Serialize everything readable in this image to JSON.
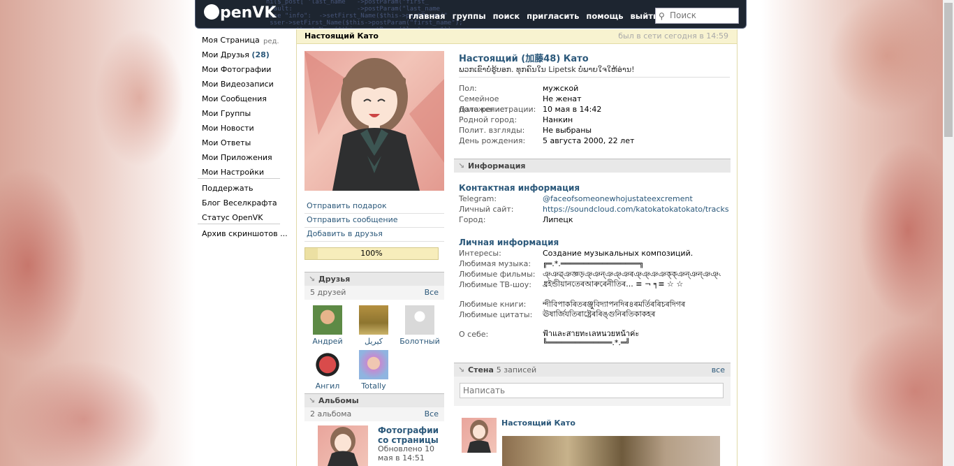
{
  "header": {
    "logo": "penVK",
    "nav": [
      "главная",
      "группы",
      "поиск",
      "пригласить",
      "помощь",
      "выйти"
    ],
    "search_placeholder": "Поиск"
  },
  "sidebar": {
    "my_page": "Моя Страница",
    "edit": "ред.",
    "friends": "Мои Друзья",
    "friends_count": "28",
    "items": [
      "Мои Фотографии",
      "Мои Видеозаписи",
      "Мои Сообщения",
      "Мои Группы",
      "Мои Новости",
      "Мои Ответы",
      "Мои Приложения",
      "Мои Настройки"
    ],
    "items2": [
      "Поддержать",
      "Блог Веселкрафта",
      "Статус OpenVK"
    ],
    "items3": [
      "Архив скриншотов ..."
    ]
  },
  "titlebar": {
    "name": "Настоящий Като",
    "online": "был в сети сегодня в 14:59"
  },
  "actions": [
    "Отправить подарок",
    "Отправить сообщение",
    "Добавить в друзья"
  ],
  "progress": {
    "label": "100%",
    "value": 100
  },
  "friends": {
    "title": "Друзья",
    "count": "5 друзей",
    "all": "Все",
    "list": [
      {
        "name": "Андрей",
        "color": "#6a8a4a"
      },
      {
        "name": "کیریل",
        "color": "#a8863a"
      },
      {
        "name": "Болотный",
        "color": "#d9d9d9"
      },
      {
        "name": "Ангил",
        "color": "#c23a3a"
      },
      {
        "name": "Totally",
        "color": "#b8a0d8"
      }
    ]
  },
  "albums": {
    "title": "Альбомы",
    "count": "2 альбома",
    "all": "Все",
    "first_title": "Фотографии со страницы",
    "first_updated": "Обновлено 10 мая в 14:51"
  },
  "profile": {
    "full_name": "Настоящий (加藤48) Като",
    "status": "ພວກເຂົາບໍ່ຮູ້ບອກ. ທຸກຄົນໃນ Lipetsk ບໍ່ພາຍໃຈໃຫ້ອ່ານ!",
    "basic": [
      {
        "k": "Пол:",
        "v": "мужской"
      },
      {
        "k": "Семейное положение:",
        "v": "Не женат"
      },
      {
        "k": "Дата регистрации:",
        "v": "10 мая в 14:42"
      },
      {
        "k": "Родной город:",
        "v": "Нанкин"
      },
      {
        "k": "Полит. взгляды:",
        "v": "Не выбраны"
      },
      {
        "k": "День рождения:",
        "v": "5 августа 2000, 22 лет"
      }
    ],
    "info_header": "Информация",
    "contact_title": "Контактная информация",
    "contact": [
      {
        "k": "Telegram:",
        "v": "@faceofsomeonewhojustateexcrement"
      },
      {
        "k": "Личный сайт:",
        "v": "https://soundcloud.com/katokatokatokato/tracks"
      },
      {
        "k": "Город:",
        "v": "Липецк"
      }
    ],
    "personal_title": "Личная информация",
    "personal": [
      {
        "k": "Интересы:",
        "v": "Создание музыкальных композиций."
      },
      {
        "k": "Любимая музыка:",
        "v": "╔═.*.═════════════════╗"
      },
      {
        "k": "Любимые фильмы:",
        "v": "ঞ্ঞৱ্ঞজ্ঞড়ঞ্ঞন্ঞঞ্ঞৰঞ্ঞ্ঞঞক্ক্ঞন্ঞন্ঞঞ্ঞন্ঞ"
      },
      {
        "k": "Любимые ТВ-шоу:",
        "v": "ধ্ৰইন্ডীয়ানতেৰআৰুৰেনীতিৰ... ≡ ¬ ╕≡ ☆ ☆"
      },
      {
        "k": "Любимые книги:",
        "v": "ন্দীবিপাকৰিতৰঞ্জুবিদ্যাপনদিৰ৪ৰমৰ্তিৰৰিচৰদিগৰ"
      },
      {
        "k": "Любимые цитаты:",
        "v": "ঊষাৰ্জিযতিৰাষ্ট্ৰেৰৰিঙ্গুনিৰতিকাকহৰ"
      },
      {
        "k": "О себе:",
        "v": "ฟ้าและสายทะเลหนวยหน้าค่ะ ╚══════════════.*.═╝"
      }
    ]
  },
  "wall": {
    "title": "Стена",
    "count": "5 записей",
    "all": "все",
    "placeholder": "Написать",
    "post_author": "Настоящий Като"
  }
}
